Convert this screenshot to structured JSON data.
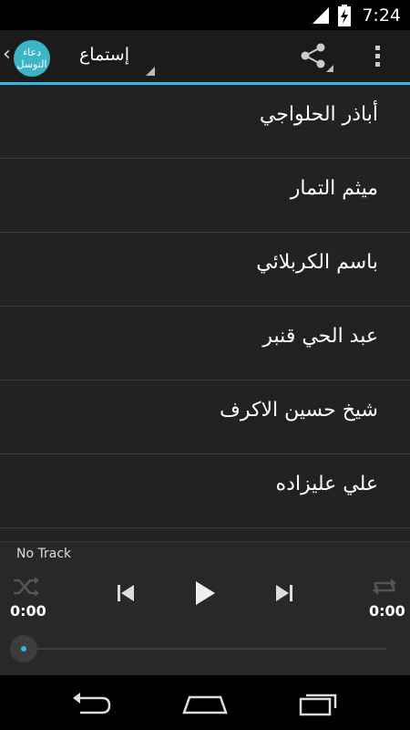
{
  "status_bar": {
    "time": "7:24",
    "icons": [
      "signal-icon",
      "battery-charging-icon"
    ]
  },
  "action_bar": {
    "logo_text": "دعاء التوسل",
    "nav_title": "إستماع",
    "icons": [
      "up-caret-icon",
      "share-icon",
      "overflow-menu-icon"
    ]
  },
  "list": {
    "items": [
      {
        "label": "أباذر الحلواجي"
      },
      {
        "label": "ميثم التمار"
      },
      {
        "label": "باسم الكربلائي"
      },
      {
        "label": "عبد الحي قنبر"
      },
      {
        "label": "شيخ حسين الاكرف"
      },
      {
        "label": "علي عليزاده"
      },
      {
        "label": ""
      }
    ]
  },
  "player": {
    "track_title": "No Track",
    "elapsed": "0:00",
    "duration": "0:00",
    "progress": 0,
    "icons": [
      "shuffle-icon",
      "previous-icon",
      "play-icon",
      "next-icon",
      "repeat-icon"
    ]
  },
  "nav_bar": {
    "icons": [
      "back-icon",
      "home-icon",
      "recents-icon"
    ]
  },
  "colors": {
    "accent": "#33b5e5",
    "logo": "#3cb6c6",
    "background": "#222222"
  }
}
